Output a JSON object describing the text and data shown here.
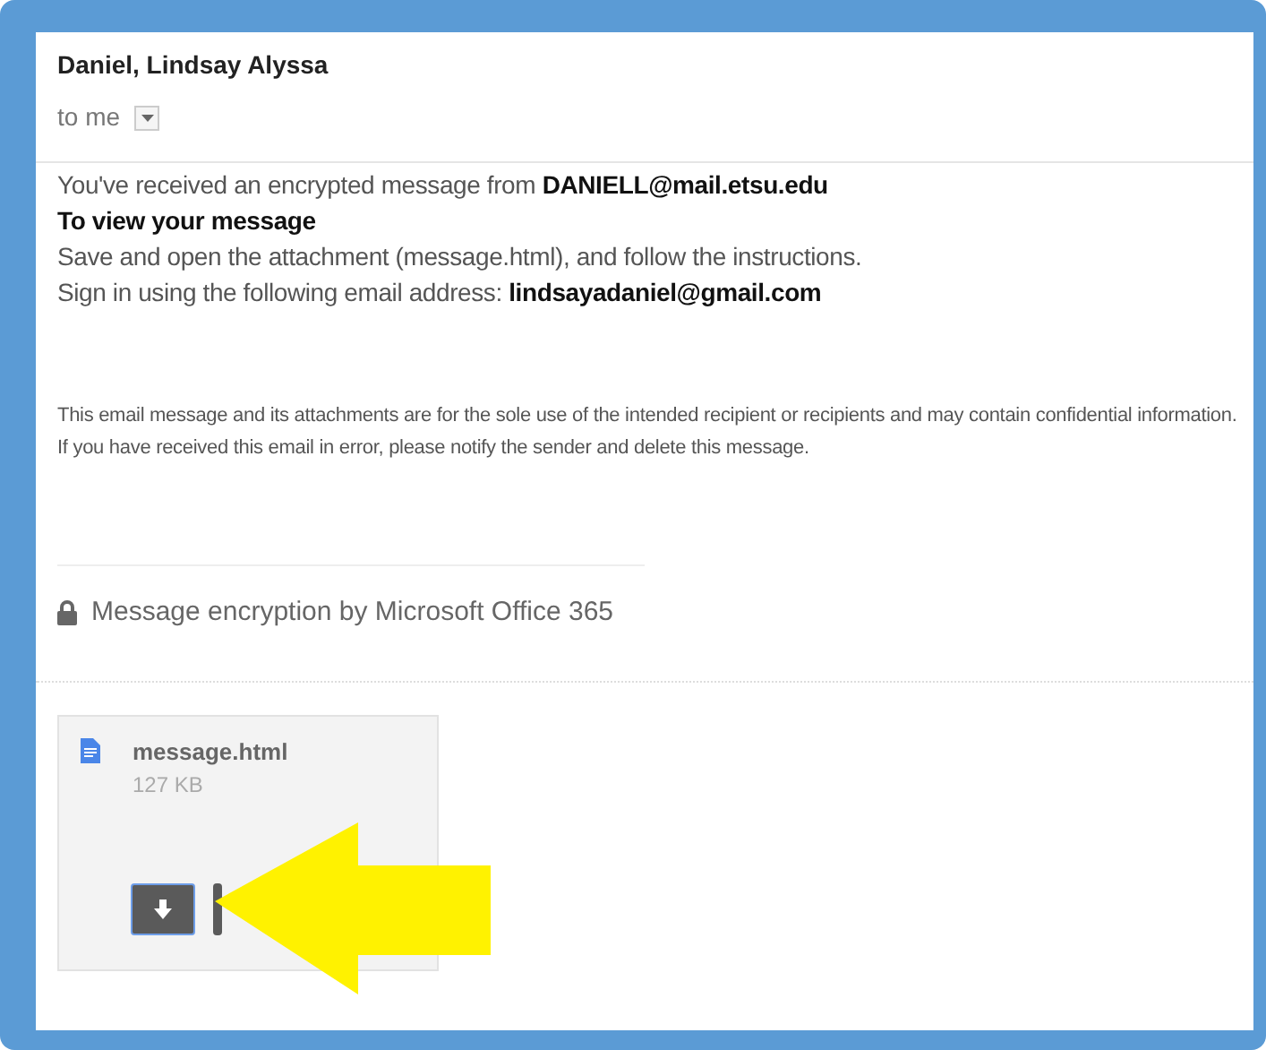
{
  "sender": "Daniel, Lindsay Alyssa",
  "recipient": "to me",
  "body": [
    "You've received an encrypted message from **DANIELL@mail.etsu.edu**",
    "**To view your message**",
    "Save and open the attachment (message.html), and follow the instructions.",
    "Sign in using the following email address: **lindsayadaniel@gmail.com**"
  ],
  "disclaimer": "This email message and its attachments are for the sole use of the intended recipient or recipients and may contain confidential information. If you have received this email in error, please notify the sender and delete this message.",
  "encryption_note": "Message encryption by Microsoft Office 365",
  "attachment": {
    "name": "message.html",
    "size": "127 KB"
  }
}
